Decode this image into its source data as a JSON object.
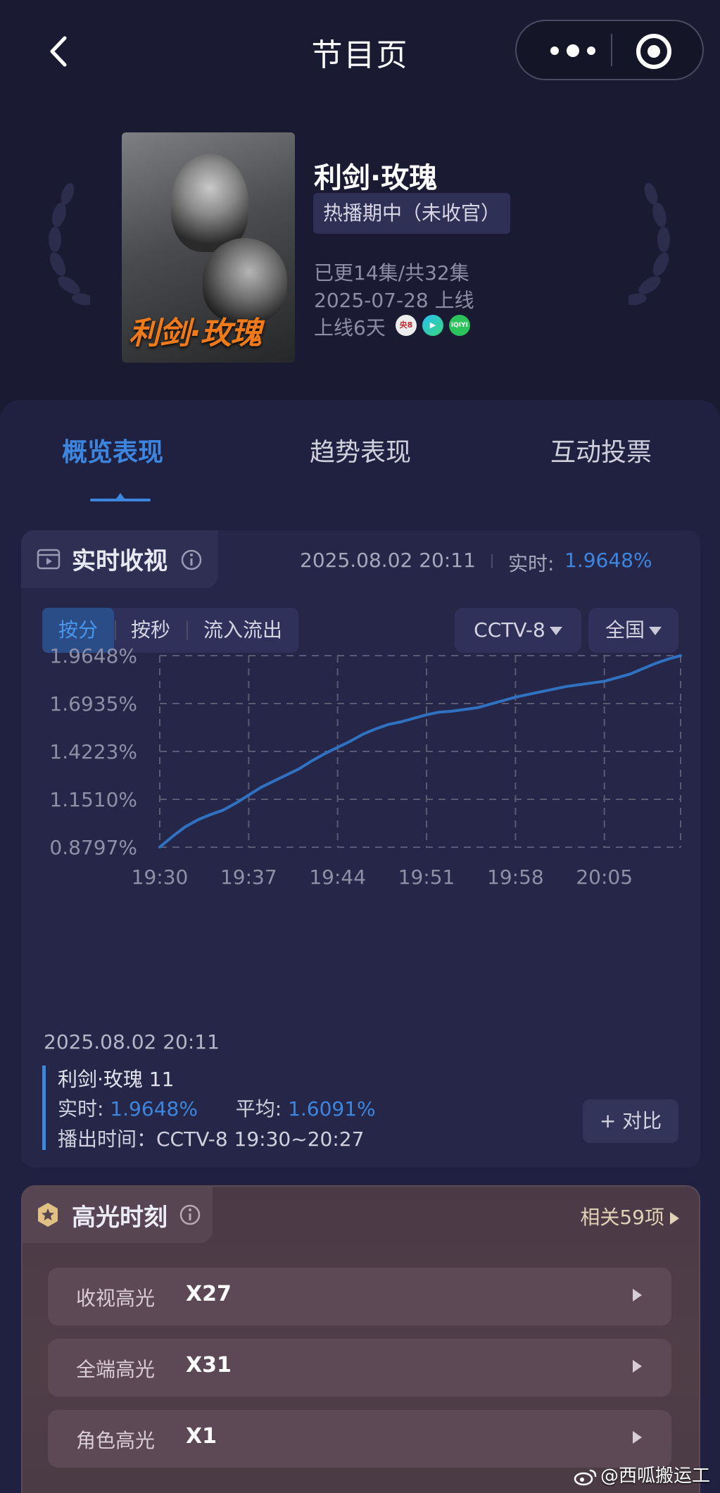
{
  "topbar": {
    "title": "节目页"
  },
  "show": {
    "name": "利剑·玫瑰",
    "poster_title": "利剑·玫瑰",
    "status": "热播期中（未收官）",
    "episodes": "已更14集/共32集",
    "premiere": "2025-07-28 上线",
    "online_days": "上线6天",
    "platform_icons": [
      "cctv8-icon",
      "tv-platform-icon",
      "iqiyi-icon"
    ],
    "platform_badges": [
      "央8",
      "▶",
      "iQIYI"
    ]
  },
  "tabs": [
    "概览表现",
    "趋势表现",
    "互动投票"
  ],
  "realtime": {
    "title": "实时收视",
    "timestamp": "2025.08.02 20:11",
    "realtime_label": "实时:",
    "realtime_value": "1.9648%",
    "modes": [
      "按分",
      "按秒",
      "流入流出"
    ],
    "channel": "CCTV-8",
    "region": "全国"
  },
  "chart_data": {
    "type": "line",
    "x": [
      "19:30",
      "19:31",
      "19:32",
      "19:33",
      "19:34",
      "19:35",
      "19:36",
      "19:37",
      "19:38",
      "19:39",
      "19:40",
      "19:41",
      "19:42",
      "19:43",
      "19:44",
      "19:45",
      "19:46",
      "19:47",
      "19:48",
      "19:49",
      "19:50",
      "19:51",
      "19:52",
      "19:53",
      "19:54",
      "19:55",
      "19:56",
      "19:57",
      "19:58",
      "19:59",
      "20:00",
      "20:01",
      "20:02",
      "20:03",
      "20:04",
      "20:05",
      "20:06",
      "20:07",
      "20:08",
      "20:09",
      "20:10",
      "20:11"
    ],
    "series": [
      {
        "values": [
          0.88,
          0.94,
          0.995,
          1.035,
          1.065,
          1.09,
          1.13,
          1.175,
          1.22,
          1.255,
          1.29,
          1.325,
          1.37,
          1.41,
          1.445,
          1.48,
          1.52,
          1.55,
          1.575,
          1.59,
          1.61,
          1.63,
          1.645,
          1.65,
          1.66,
          1.67,
          1.69,
          1.71,
          1.73,
          1.745,
          1.76,
          1.775,
          1.79,
          1.8,
          1.81,
          1.82,
          1.84,
          1.86,
          1.89,
          1.92,
          1.945,
          1.965
        ]
      }
    ],
    "x_ticks": [
      "19:30",
      "19:37",
      "19:44",
      "19:51",
      "19:58",
      "20:05"
    ],
    "y_ticks": [
      "0.8797%",
      "1.1510%",
      "1.4223%",
      "1.6935%",
      "1.9648%"
    ],
    "ylim": [
      0.8797,
      1.9648
    ],
    "grid": true,
    "color": "#2f72c2"
  },
  "detail": {
    "timestamp": "2025.08.02 20:11",
    "episode": "利剑·玫瑰 11",
    "realtime_label": "实时:",
    "realtime_value": "1.9648%",
    "average_label": "平均:",
    "average_value": "1.6091%",
    "air_time": "播出时间：CCTV-8 19:30~20:27",
    "compare": "+ 对比"
  },
  "highlights": {
    "title": "高光时刻",
    "related": "相关59项",
    "items": [
      {
        "label": "收视高光",
        "count": "X27"
      },
      {
        "label": "全端高光",
        "count": "X31"
      },
      {
        "label": "角色高光",
        "count": "X1"
      }
    ]
  },
  "watermark": "@西呱搬运工",
  "colors": {
    "accent": "#3d86e0",
    "background": "#1a1a33",
    "card": "#202040",
    "highlight_panel": "#4b3a46"
  }
}
